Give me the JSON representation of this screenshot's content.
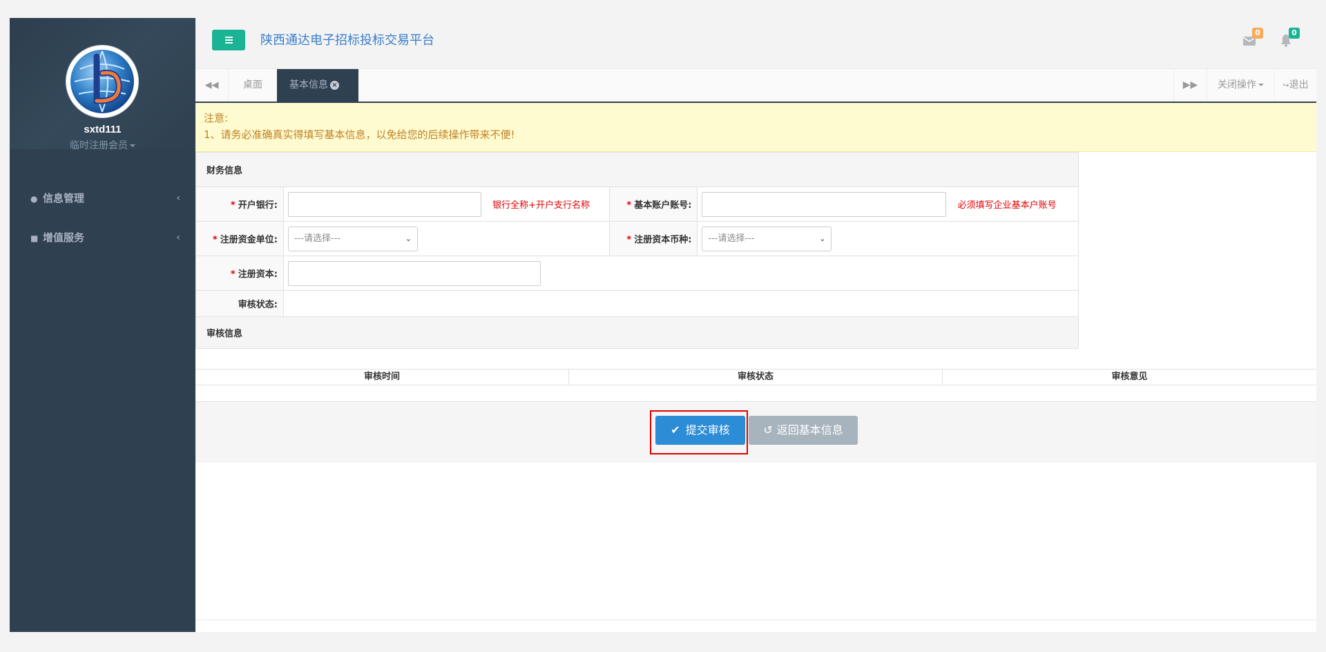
{
  "user": {
    "name": "sxtd111",
    "role": "临时注册会员"
  },
  "sidebar": {
    "items": [
      {
        "label": "信息管理",
        "icon": "user-icon"
      },
      {
        "label": "增值服务",
        "icon": "book-icon"
      }
    ]
  },
  "header": {
    "title": "陕西通达电子招标投标交易平台",
    "mail_count": "0",
    "bell_count": "0",
    "colors": {
      "menu": "#1ab394",
      "mail_badge": "#f8ac59",
      "bell_badge": "#1ab394"
    }
  },
  "tabs": {
    "desk": "桌面",
    "active": "基本信息",
    "close_ops": "关闭操作",
    "logout": "退出"
  },
  "notice": {
    "title": "注意:",
    "line1": "1、请务必准确真实得填写基本信息，以免给您的后续操作带来不便!"
  },
  "form": {
    "finance_header": "财务信息",
    "bank_label": "开户银行:",
    "bank_value": "",
    "bank_hint": "银行全称+开户支行名称",
    "account_label": "基本账户账号:",
    "account_value": "",
    "account_hint": "必须填写企业基本户账号",
    "capital_unit_label": "注册资金单位:",
    "capital_unit_value": "---请选择---",
    "currency_label": "注册资本币种:",
    "currency_value": "---请选择---",
    "capital_label": "注册资本:",
    "capital_value": "",
    "status_label": "审核状态:",
    "status_value": "",
    "audit_header": "审核信息"
  },
  "audit_table": {
    "columns": [
      "审核时间",
      "审核状态",
      "审核意见"
    ]
  },
  "buttons": {
    "submit": "提交审核",
    "back": "返回基本信息"
  }
}
